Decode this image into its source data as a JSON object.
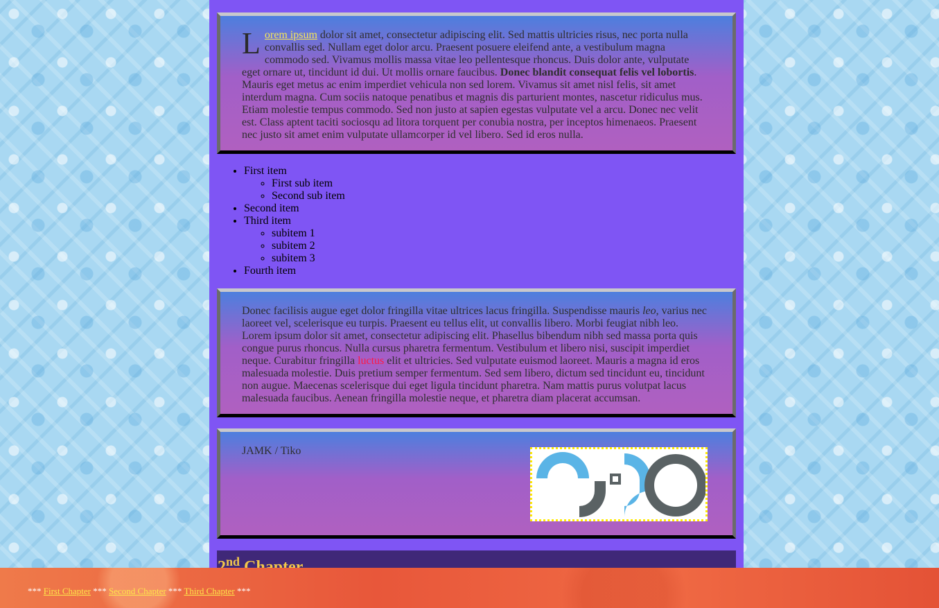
{
  "box1": {
    "dropcap": "L",
    "link_text": "orem ipsum",
    "text_a": " dolor sit amet, consectetur adipiscing elit. Sed mattis ultricies risus, nec porta nulla convallis sed. Nullam eget dolor arcu. Praesent posuere eleifend ante, a vestibulum magna commodo sed. Vivamus mollis massa vitae leo pellentesque rhoncus. Duis dolor ante, vulputate eget ornare ut, tincidunt id dui. Ut mollis ornare faucibus. ",
    "bold_text": "Donec blandit consequat felis vel lobortis",
    "text_b": ". Mauris eget metus ac enim imperdiet vehicula non sed lorem. Vivamus sit amet nisl felis, sit amet interdum magna. Cum sociis natoque penatibus et magnis dis parturient montes, nascetur ridiculus mus. Etiam molestie tempus commodo. Sed non justo at sapien egestas vulputate vel a arcu. Donec nec velit est. Class aptent taciti sociosqu ad litora torquent per conubia nostra, per inceptos himenaeos. Praesent nec justo sit amet enim vulputate ullamcorper id vel libero. Sed id eros nulla."
  },
  "list": {
    "item1": "First item",
    "item1_subs": [
      "First sub item",
      "Second sub item"
    ],
    "item2": "Second item",
    "item3": "Third item",
    "item3_subs": [
      "subitem 1",
      "subitem 2",
      "subitem 3"
    ],
    "item4": "Fourth item"
  },
  "box2": {
    "text_a": "Donec facilisis augue eget dolor fringilla vitae ultrices lacus fringilla. Suspendisse mauris ",
    "italic_text": "leo",
    "text_b": ", varius nec laoreet vel, scelerisque eu turpis. Praesent eu tellus elit, ut convallis libero. Morbi feugiat nibh leo. Lorem ipsum dolor sit amet, consectetur adipiscing elit. Phasellus bibendum nibh sed massa porta quis congue purus rhoncus. Nulla cursus pharetra fermentum. Vestibulum et libero nisi, suscipit imperdiet neque. Curabitur fringilla ",
    "red_text": "luctus",
    "text_c": " elit et ultricies. Sed vulputate euismod laoreet. Mauris a magna id eros malesuada molestie. Duis pretium semper fermentum. Sed sem libero, dictum sed tincidunt eu, tincidunt non augue. Maecenas scelerisque dui eget ligula tincidunt pharetra. Nam mattis purus volutpat lacus malesuada faucibus. Aenean fringilla molestie neque, et pharetra diam placerat accumsan."
  },
  "box3": {
    "org_text": "JAMK / Tiko",
    "logo_icon": "tiko-logo-icon",
    "logo_colors": {
      "blue": "#5ab4e6",
      "gray": "#5a6264"
    }
  },
  "chapter2": {
    "number": "2",
    "suffix": "nd",
    "word": " Chapter"
  },
  "footer": {
    "sep": "***",
    "links": [
      "First Chapter",
      "Second Chapter",
      "Third Chapter"
    ]
  }
}
